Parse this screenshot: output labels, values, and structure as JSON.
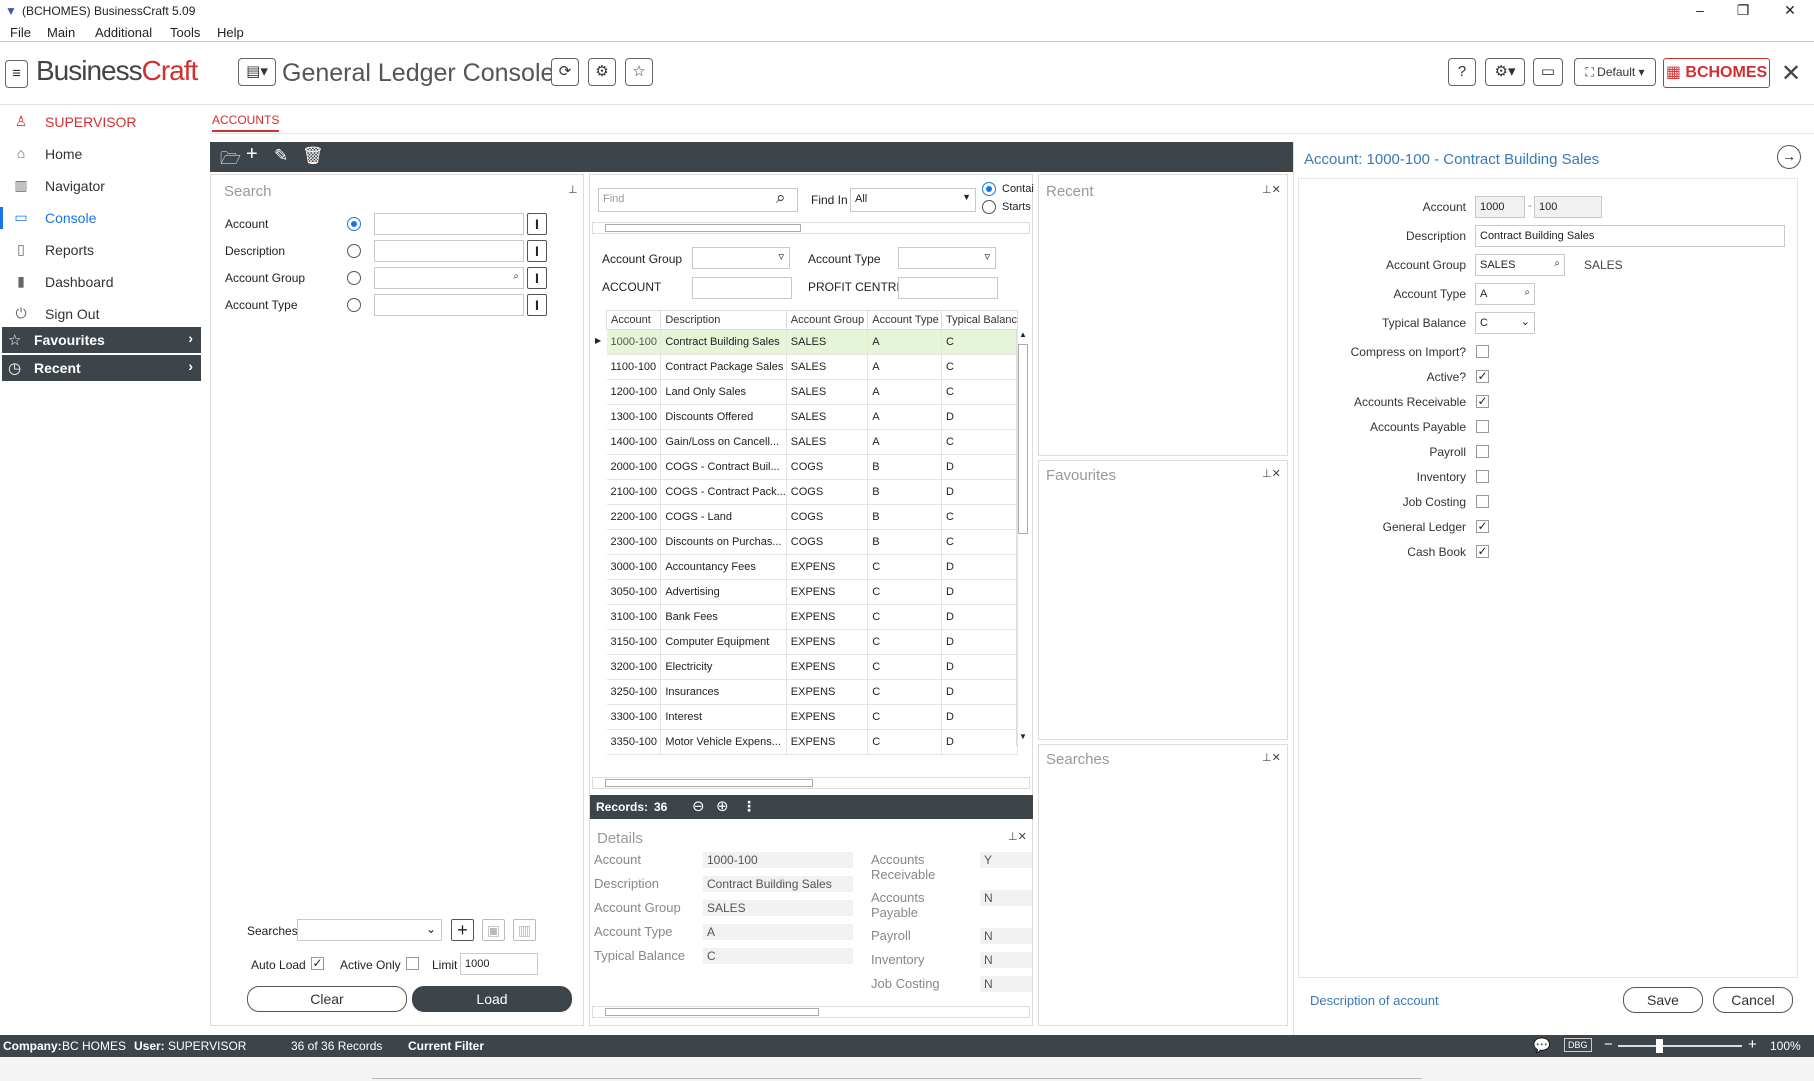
{
  "window": {
    "title": "(BCHOMES) BusinessCraft  5.09"
  },
  "menu": [
    "File",
    "Main",
    "Additional",
    "Tools",
    "Help"
  ],
  "header": {
    "brand_a": "Business",
    "brand_b": "Craft",
    "title": "General Ledger Console",
    "layout": "Default",
    "company_badge": "BCHOMES"
  },
  "sidebar": {
    "user": "SUPERVISOR",
    "items": [
      {
        "label": "Home",
        "icon": "home-icon"
      },
      {
        "label": "Navigator",
        "icon": "map-icon"
      },
      {
        "label": "Console",
        "icon": "console-icon"
      },
      {
        "label": "Reports",
        "icon": "reports-icon"
      },
      {
        "label": "Dashboard",
        "icon": "dashboard-icon"
      },
      {
        "label": "Sign Out",
        "icon": "power-icon"
      }
    ],
    "favourites": "Favourites",
    "recent": "Recent"
  },
  "tab": "ACCOUNTS",
  "search": {
    "title": "Search",
    "fields": [
      "Account",
      "Description",
      "Account Group",
      "Account Type"
    ],
    "searches_label": "Searches",
    "auto_load_label": "Auto Load",
    "active_only_label": "Active Only",
    "limit_label": "Limit",
    "limit_value": "1000",
    "clear": "Clear",
    "load": "Load"
  },
  "list": {
    "find_placeholder": "Find",
    "find_in_label": "Find In",
    "find_in_value": "All",
    "radio_contains": "Contai",
    "radio_starts": "Starts",
    "account_group_label": "Account Group",
    "account_type_label": "Account Type",
    "account_label": "ACCOUNT",
    "profit_centre_label": "PROFIT CENTRE",
    "columns": [
      "Account",
      "Description",
      "Account Group",
      "Account Type",
      "Typical Balanc"
    ],
    "rows": [
      [
        "1000-100",
        "Contract Building Sales",
        "SALES",
        "A",
        "C"
      ],
      [
        "1100-100",
        "Contract Package Sales",
        "SALES",
        "A",
        "C"
      ],
      [
        "1200-100",
        "Land Only Sales",
        "SALES",
        "A",
        "C"
      ],
      [
        "1300-100",
        "Discounts Offered",
        "SALES",
        "A",
        "D"
      ],
      [
        "1400-100",
        "Gain/Loss on Cancell...",
        "SALES",
        "A",
        "C"
      ],
      [
        "2000-100",
        "COGS - Contract Buil...",
        "COGS",
        "B",
        "D"
      ],
      [
        "2100-100",
        "COGS - Contract Pack...",
        "COGS",
        "B",
        "D"
      ],
      [
        "2200-100",
        "COGS - Land",
        "COGS",
        "B",
        "C"
      ],
      [
        "2300-100",
        "Discounts on Purchas...",
        "COGS",
        "B",
        "C"
      ],
      [
        "3000-100",
        "Accountancy Fees",
        "EXPENS",
        "C",
        "D"
      ],
      [
        "3050-100",
        "Advertising",
        "EXPENS",
        "C",
        "D"
      ],
      [
        "3100-100",
        "Bank Fees",
        "EXPENS",
        "C",
        "D"
      ],
      [
        "3150-100",
        "Computer Equipment",
        "EXPENS",
        "C",
        "D"
      ],
      [
        "3200-100",
        "Electricity",
        "EXPENS",
        "C",
        "D"
      ],
      [
        "3250-100",
        "Insurances",
        "EXPENS",
        "C",
        "D"
      ],
      [
        "3300-100",
        "Interest",
        "EXPENS",
        "C",
        "D"
      ],
      [
        "3350-100",
        "Motor Vehicle Expens...",
        "EXPENS",
        "C",
        "D"
      ]
    ],
    "records_label": "Records:",
    "records_count": "36"
  },
  "details": {
    "title": "Details",
    "left": [
      {
        "label": "Account",
        "value": "1000-100"
      },
      {
        "label": "Description",
        "value": "Contract Building Sales"
      },
      {
        "label": "Account Group",
        "value": "SALES"
      },
      {
        "label": "Account Type",
        "value": "A"
      },
      {
        "label": "Typical Balance",
        "value": "C"
      }
    ],
    "right": [
      {
        "label": "Accounts Receivable",
        "value": "Y"
      },
      {
        "label": "Accounts Payable",
        "value": "N"
      },
      {
        "label": "Payroll",
        "value": "N"
      },
      {
        "label": "Inventory",
        "value": "N"
      },
      {
        "label": "Job Costing",
        "value": "N"
      }
    ]
  },
  "side_panels": {
    "recent": "Recent",
    "favourites": "Favourites",
    "searches": "Searches"
  },
  "account_panel": {
    "title": "Account: 1000-100 - Contract Building Sales",
    "account_label": "Account",
    "account_a": "1000",
    "account_b": "100",
    "description_label": "Description",
    "description_value": "Contract Building Sales",
    "group_label": "Account Group",
    "group_value": "SALES",
    "group_desc": "SALES",
    "type_label": "Account Type",
    "type_value": "A",
    "balance_label": "Typical Balance",
    "balance_value": "C",
    "checks": [
      {
        "label": "Compress on Import?",
        "checked": false
      },
      {
        "label": "Active?",
        "checked": true
      },
      {
        "label": "Accounts Receivable",
        "checked": true
      },
      {
        "label": "Accounts Payable",
        "checked": false
      },
      {
        "label": "Payroll",
        "checked": false
      },
      {
        "label": "Inventory",
        "checked": false
      },
      {
        "label": "Job Costing",
        "checked": false
      },
      {
        "label": "General Ledger",
        "checked": true
      },
      {
        "label": "Cash Book",
        "checked": true
      }
    ],
    "footer_hint": "Description of account",
    "save": "Save",
    "cancel": "Cancel"
  },
  "status": {
    "company_label": "Company:",
    "company": "BC HOMES",
    "user_label": "User:",
    "user": "SUPERVISOR",
    "records": "36 of 36 Records",
    "filter": "Current Filter",
    "dbg": "DBG",
    "zoom": "100%"
  }
}
